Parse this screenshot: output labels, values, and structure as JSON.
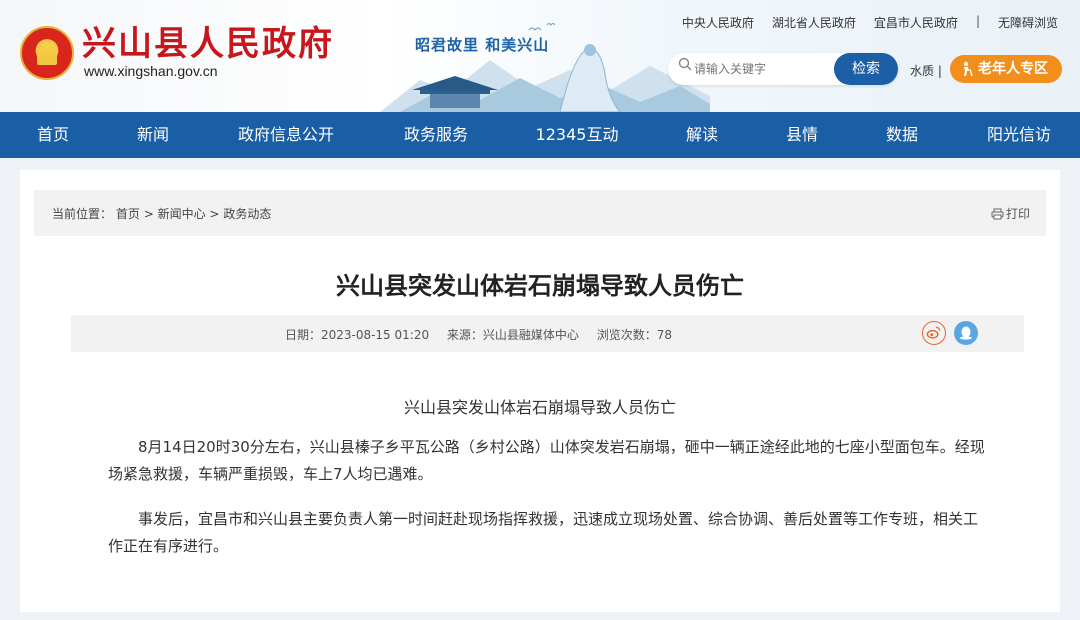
{
  "header": {
    "site_title": "兴山县人民政府",
    "site_url": "www.xingshan.gov.cn",
    "slogan": "昭君故里  和美兴山",
    "top_links": [
      "中央人民政府",
      "湖北省人民政府",
      "宜昌市人民政府",
      "无障碍浏览"
    ],
    "top_separator": "|",
    "search_placeholder": "请输入关键字",
    "search_button": "检索",
    "water_quality": "水质",
    "water_separator": "|",
    "elder_zone": "老年人专区"
  },
  "nav": {
    "items": [
      "首页",
      "新闻",
      "政府信息公开",
      "政务服务",
      "12345互动",
      "解读",
      "县情",
      "数据",
      "阳光信访"
    ]
  },
  "breadcrumb": {
    "prefix": "当前位置：",
    "items": [
      "首页",
      "新闻中心",
      "政务动态"
    ],
    "separator": ">"
  },
  "print_label": "打印",
  "article": {
    "title": "兴山县突发山体岩石崩塌导致人员伤亡",
    "date": "日期：2023-08-15 01:20",
    "source": "来源：兴山县融媒体中心",
    "views": "浏览次数：78",
    "subtitle": "兴山县突发山体岩石崩塌导致人员伤亡",
    "paragraphs": [
      "8月14日20时30分左右，兴山县榛子乡平瓦公路（乡村公路）山体突发岩石崩塌，砸中一辆正途经此地的七座小型面包车。经现场紧急救援，车辆严重损毁，车上7人均已遇难。",
      "事发后，宜昌市和兴山县主要负责人第一时间赶赴现场指挥救援，迅速成立现场处置、综合协调、善后处置等工作专班，相关工作正在有序进行。"
    ]
  },
  "colors": {
    "nav_blue": "#1a5ea5",
    "title_red": "#c8161d",
    "elder_orange": "#f18e1c"
  }
}
